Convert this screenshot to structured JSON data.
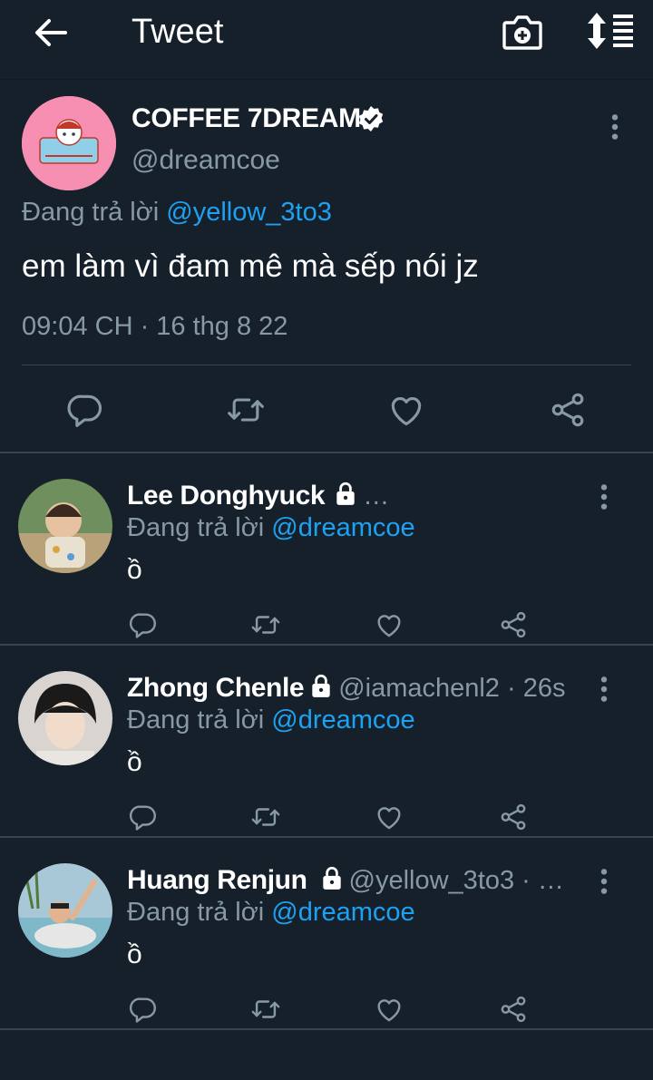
{
  "header": {
    "title": "Tweet"
  },
  "tweet": {
    "author_name": "COFFEE 7DREAM",
    "author_handle": "@dreamcoe",
    "replying_prefix": "Đang trả lời",
    "replying_to": "@yellow_3to3",
    "text": "em làm vì đam mê mà sếp nói jz",
    "timestamp": "09:04 CH · 16 thg 8 22"
  },
  "replies": [
    {
      "name": "Lee Donghyuck",
      "handle": "…",
      "replying_prefix": "Đang trả lời",
      "replying_to": "@dreamcoe",
      "text": "ồ"
    },
    {
      "name": "Zhong Chenle",
      "handle": "@iamachenl2 · 26s",
      "replying_prefix": "Đang trả lời",
      "replying_to": "@dreamcoe",
      "text": "ồ"
    },
    {
      "name": "Huang Renjun",
      "handle": "@yellow_3to3 · …",
      "replying_prefix": "Đang trả lời",
      "replying_to": "@dreamcoe",
      "text": "ồ"
    }
  ],
  "colors": {
    "background": "#15202b",
    "link": "#1da1f2",
    "muted": "#8899a6",
    "divider": "#38444d"
  }
}
